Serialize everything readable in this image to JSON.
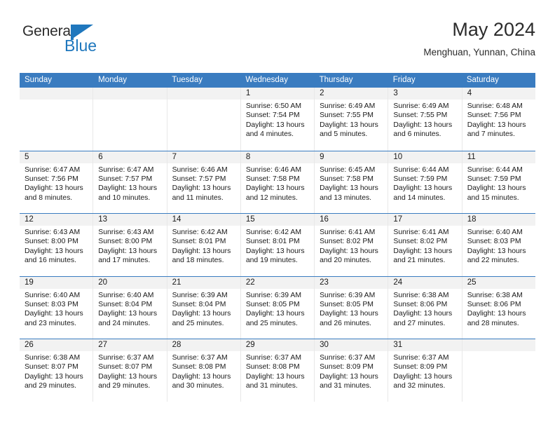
{
  "brand": {
    "name_part1": "General",
    "name_part2": "Blue",
    "flag_icon": "flag-triangle-icon",
    "accent_color": "#1f77bd"
  },
  "header": {
    "title": "May 2024",
    "subtitle": "Menghuan, Yunnan, China"
  },
  "calendar": {
    "header_color": "#3a7cc0",
    "day_band_color": "#f2f2f2",
    "weekdays": [
      "Sunday",
      "Monday",
      "Tuesday",
      "Wednesday",
      "Thursday",
      "Friday",
      "Saturday"
    ],
    "weeks": [
      [
        {
          "day": "",
          "empty": true
        },
        {
          "day": "",
          "empty": true
        },
        {
          "day": "",
          "empty": true
        },
        {
          "day": "1",
          "sunrise": "Sunrise: 6:50 AM",
          "sunset": "Sunset: 7:54 PM",
          "daylight_line1": "Daylight: 13 hours",
          "daylight_line2": "and 4 minutes."
        },
        {
          "day": "2",
          "sunrise": "Sunrise: 6:49 AM",
          "sunset": "Sunset: 7:55 PM",
          "daylight_line1": "Daylight: 13 hours",
          "daylight_line2": "and 5 minutes."
        },
        {
          "day": "3",
          "sunrise": "Sunrise: 6:49 AM",
          "sunset": "Sunset: 7:55 PM",
          "daylight_line1": "Daylight: 13 hours",
          "daylight_line2": "and 6 minutes."
        },
        {
          "day": "4",
          "sunrise": "Sunrise: 6:48 AM",
          "sunset": "Sunset: 7:56 PM",
          "daylight_line1": "Daylight: 13 hours",
          "daylight_line2": "and 7 minutes."
        }
      ],
      [
        {
          "day": "5",
          "sunrise": "Sunrise: 6:47 AM",
          "sunset": "Sunset: 7:56 PM",
          "daylight_line1": "Daylight: 13 hours",
          "daylight_line2": "and 8 minutes."
        },
        {
          "day": "6",
          "sunrise": "Sunrise: 6:47 AM",
          "sunset": "Sunset: 7:57 PM",
          "daylight_line1": "Daylight: 13 hours",
          "daylight_line2": "and 10 minutes."
        },
        {
          "day": "7",
          "sunrise": "Sunrise: 6:46 AM",
          "sunset": "Sunset: 7:57 PM",
          "daylight_line1": "Daylight: 13 hours",
          "daylight_line2": "and 11 minutes."
        },
        {
          "day": "8",
          "sunrise": "Sunrise: 6:46 AM",
          "sunset": "Sunset: 7:58 PM",
          "daylight_line1": "Daylight: 13 hours",
          "daylight_line2": "and 12 minutes."
        },
        {
          "day": "9",
          "sunrise": "Sunrise: 6:45 AM",
          "sunset": "Sunset: 7:58 PM",
          "daylight_line1": "Daylight: 13 hours",
          "daylight_line2": "and 13 minutes."
        },
        {
          "day": "10",
          "sunrise": "Sunrise: 6:44 AM",
          "sunset": "Sunset: 7:59 PM",
          "daylight_line1": "Daylight: 13 hours",
          "daylight_line2": "and 14 minutes."
        },
        {
          "day": "11",
          "sunrise": "Sunrise: 6:44 AM",
          "sunset": "Sunset: 7:59 PM",
          "daylight_line1": "Daylight: 13 hours",
          "daylight_line2": "and 15 minutes."
        }
      ],
      [
        {
          "day": "12",
          "sunrise": "Sunrise: 6:43 AM",
          "sunset": "Sunset: 8:00 PM",
          "daylight_line1": "Daylight: 13 hours",
          "daylight_line2": "and 16 minutes."
        },
        {
          "day": "13",
          "sunrise": "Sunrise: 6:43 AM",
          "sunset": "Sunset: 8:00 PM",
          "daylight_line1": "Daylight: 13 hours",
          "daylight_line2": "and 17 minutes."
        },
        {
          "day": "14",
          "sunrise": "Sunrise: 6:42 AM",
          "sunset": "Sunset: 8:01 PM",
          "daylight_line1": "Daylight: 13 hours",
          "daylight_line2": "and 18 minutes."
        },
        {
          "day": "15",
          "sunrise": "Sunrise: 6:42 AM",
          "sunset": "Sunset: 8:01 PM",
          "daylight_line1": "Daylight: 13 hours",
          "daylight_line2": "and 19 minutes."
        },
        {
          "day": "16",
          "sunrise": "Sunrise: 6:41 AM",
          "sunset": "Sunset: 8:02 PM",
          "daylight_line1": "Daylight: 13 hours",
          "daylight_line2": "and 20 minutes."
        },
        {
          "day": "17",
          "sunrise": "Sunrise: 6:41 AM",
          "sunset": "Sunset: 8:02 PM",
          "daylight_line1": "Daylight: 13 hours",
          "daylight_line2": "and 21 minutes."
        },
        {
          "day": "18",
          "sunrise": "Sunrise: 6:40 AM",
          "sunset": "Sunset: 8:03 PM",
          "daylight_line1": "Daylight: 13 hours",
          "daylight_line2": "and 22 minutes."
        }
      ],
      [
        {
          "day": "19",
          "sunrise": "Sunrise: 6:40 AM",
          "sunset": "Sunset: 8:03 PM",
          "daylight_line1": "Daylight: 13 hours",
          "daylight_line2": "and 23 minutes."
        },
        {
          "day": "20",
          "sunrise": "Sunrise: 6:40 AM",
          "sunset": "Sunset: 8:04 PM",
          "daylight_line1": "Daylight: 13 hours",
          "daylight_line2": "and 24 minutes."
        },
        {
          "day": "21",
          "sunrise": "Sunrise: 6:39 AM",
          "sunset": "Sunset: 8:04 PM",
          "daylight_line1": "Daylight: 13 hours",
          "daylight_line2": "and 25 minutes."
        },
        {
          "day": "22",
          "sunrise": "Sunrise: 6:39 AM",
          "sunset": "Sunset: 8:05 PM",
          "daylight_line1": "Daylight: 13 hours",
          "daylight_line2": "and 25 minutes."
        },
        {
          "day": "23",
          "sunrise": "Sunrise: 6:39 AM",
          "sunset": "Sunset: 8:05 PM",
          "daylight_line1": "Daylight: 13 hours",
          "daylight_line2": "and 26 minutes."
        },
        {
          "day": "24",
          "sunrise": "Sunrise: 6:38 AM",
          "sunset": "Sunset: 8:06 PM",
          "daylight_line1": "Daylight: 13 hours",
          "daylight_line2": "and 27 minutes."
        },
        {
          "day": "25",
          "sunrise": "Sunrise: 6:38 AM",
          "sunset": "Sunset: 8:06 PM",
          "daylight_line1": "Daylight: 13 hours",
          "daylight_line2": "and 28 minutes."
        }
      ],
      [
        {
          "day": "26",
          "sunrise": "Sunrise: 6:38 AM",
          "sunset": "Sunset: 8:07 PM",
          "daylight_line1": "Daylight: 13 hours",
          "daylight_line2": "and 29 minutes."
        },
        {
          "day": "27",
          "sunrise": "Sunrise: 6:37 AM",
          "sunset": "Sunset: 8:07 PM",
          "daylight_line1": "Daylight: 13 hours",
          "daylight_line2": "and 29 minutes."
        },
        {
          "day": "28",
          "sunrise": "Sunrise: 6:37 AM",
          "sunset": "Sunset: 8:08 PM",
          "daylight_line1": "Daylight: 13 hours",
          "daylight_line2": "and 30 minutes."
        },
        {
          "day": "29",
          "sunrise": "Sunrise: 6:37 AM",
          "sunset": "Sunset: 8:08 PM",
          "daylight_line1": "Daylight: 13 hours",
          "daylight_line2": "and 31 minutes."
        },
        {
          "day": "30",
          "sunrise": "Sunrise: 6:37 AM",
          "sunset": "Sunset: 8:09 PM",
          "daylight_line1": "Daylight: 13 hours",
          "daylight_line2": "and 31 minutes."
        },
        {
          "day": "31",
          "sunrise": "Sunrise: 6:37 AM",
          "sunset": "Sunset: 8:09 PM",
          "daylight_line1": "Daylight: 13 hours",
          "daylight_line2": "and 32 minutes."
        },
        {
          "day": "",
          "empty": true
        }
      ]
    ]
  }
}
